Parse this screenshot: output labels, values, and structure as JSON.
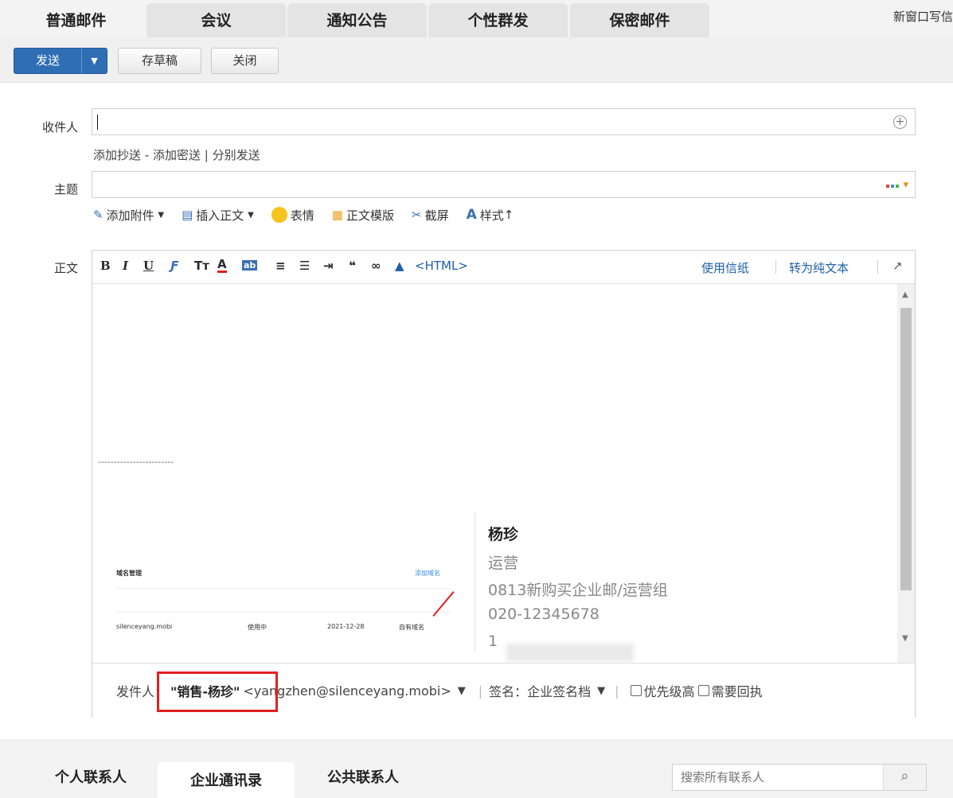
{
  "top_tabs": [
    "普通邮件",
    "会议",
    "通知公告",
    "个性群发",
    "保密邮件"
  ],
  "new_window_label": "新窗口写信",
  "toolbar": {
    "send_label": "发送",
    "draft_label": "存草稿",
    "close_label": "关闭"
  },
  "recipient": {
    "label": "收件人",
    "value": ""
  },
  "links": {
    "cc": "添加抄送",
    "sep1": " - ",
    "bcc": "添加密送",
    "sep2": " | ",
    "separate": "分别发送"
  },
  "subject": {
    "label": "主题",
    "value": ""
  },
  "attach_bar": {
    "attach": "添加附件",
    "insert": "插入正文",
    "emoji": "表情",
    "template": "正文模版",
    "screenshot": "截屏",
    "style": "样式"
  },
  "body": {
    "label": "正文",
    "html_label": "<HTML>",
    "stationery": "使用信纸",
    "plain_text": "转为纯文本",
    "separator": "------------------------"
  },
  "signature": {
    "name": "杨珍",
    "title": "运营",
    "dept": "0813新购买企业邮/运营组",
    "phone": "020-12345678",
    "mobile": "1",
    "img_text": {
      "title": "域名管理",
      "add": "添加域名",
      "domain": "silenceyang.mobi",
      "status": "使用中",
      "date": "2021-12-28",
      "source": "自有域名"
    }
  },
  "footer": {
    "sender_label": "发件人：",
    "sender_name": "\"销售-杨珍\"",
    "sender_email": "<yangzhen@silenceyang.mobi>",
    "signature_label": "签名：",
    "signature_value": "企业签名档",
    "priority": "优先级高",
    "receipt": "需要回执"
  },
  "bottom_tabs": [
    "个人联系人",
    "企业通讯录",
    "公共联系人"
  ],
  "search": {
    "placeholder": "搜索所有联系人"
  },
  "colors": {
    "send": "#2f6db5",
    "link": "#1e5fa8",
    "highlight": "#e02020"
  }
}
